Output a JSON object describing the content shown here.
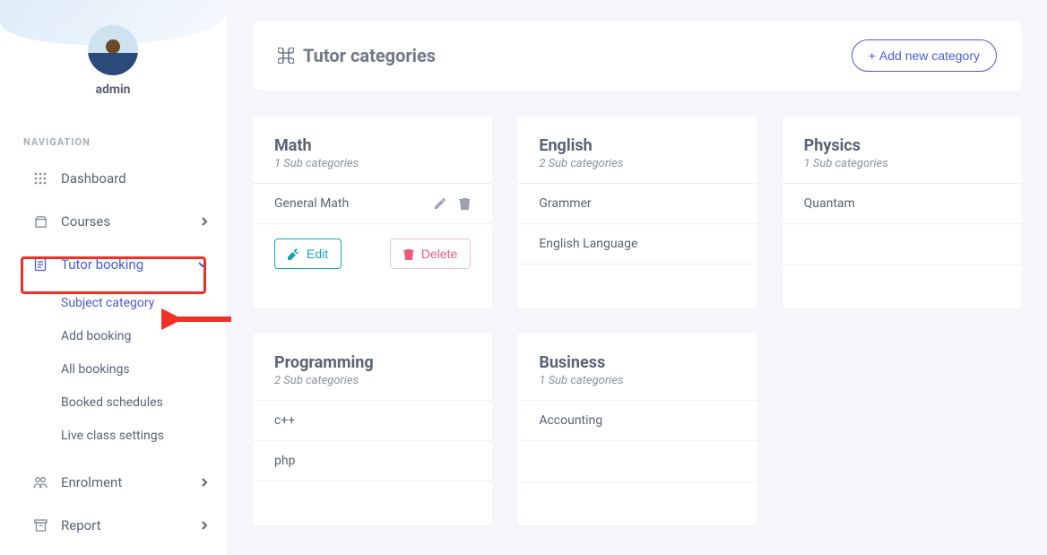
{
  "sidebar": {
    "username": "admin",
    "nav_label": "NAVIGATION",
    "items": {
      "dashboard": "Dashboard",
      "courses": "Courses",
      "tutor_booking": "Tutor booking",
      "enrolment": "Enrolment",
      "report": "Report"
    },
    "subitems": {
      "subject_category": "Subject category",
      "add_booking": "Add booking",
      "all_bookings": "All bookings",
      "booked_schedules": "Booked schedules",
      "live_class_settings": "Live class settings"
    }
  },
  "header": {
    "title": "Tutor categories",
    "add_button": "Add new category"
  },
  "cards": {
    "math": {
      "title": "Math",
      "subtitle": "1 Sub categories",
      "rows": [
        "General Math"
      ],
      "edit_label": "Edit",
      "delete_label": "Delete"
    },
    "english": {
      "title": "English",
      "subtitle": "2 Sub categories",
      "rows": [
        "Grammer",
        "English Language"
      ]
    },
    "physics": {
      "title": "Physics",
      "subtitle": "1 Sub categories",
      "rows": [
        "Quantam"
      ]
    },
    "programming": {
      "title": "Programming",
      "subtitle": "2 Sub categories",
      "rows": [
        "c++",
        "php"
      ]
    },
    "business": {
      "title": "Business",
      "subtitle": "1 Sub categories",
      "rows": [
        "Accounting"
      ]
    }
  }
}
